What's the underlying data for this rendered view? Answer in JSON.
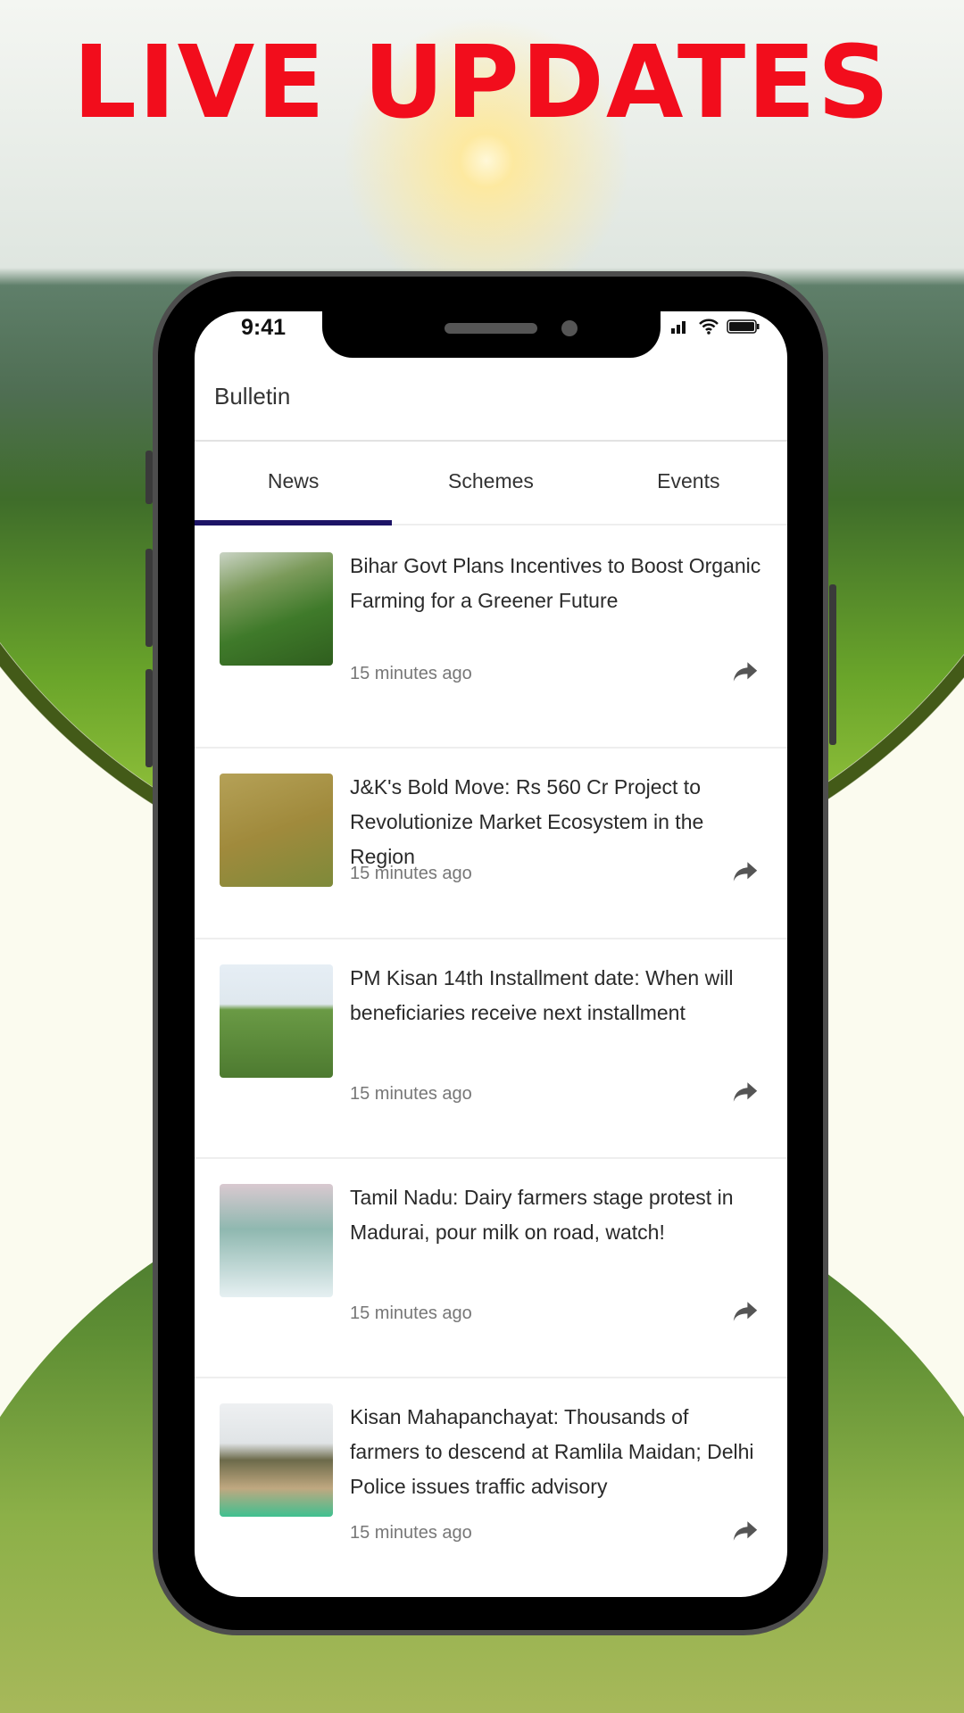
{
  "banner": {
    "headline": "LIVE UPDATES"
  },
  "status_bar": {
    "time": "9:41"
  },
  "app": {
    "title": "Bulletin",
    "tabs": [
      {
        "label": "News",
        "active": true
      },
      {
        "label": "Schemes"
      },
      {
        "label": "Events"
      }
    ],
    "accent_color": "#1d1466",
    "news": [
      {
        "title": "Bihar Govt Plans Incentives to Boost Organic Farming for a Greener Future",
        "time": "15 minutes ago"
      },
      {
        "title": "J&K's Bold Move: Rs 560 Cr Project to Revolutionize Market Ecosystem in the Region",
        "time": "15 minutes ago"
      },
      {
        "title": "PM Kisan 14th Installment date: When will beneficiaries receive next installment",
        "time": "15 minutes ago"
      },
      {
        "title": "Tamil Nadu: Dairy farmers stage protest in Madurai, pour milk on road, watch!",
        "time": "15 minutes ago"
      },
      {
        "title": "Kisan Mahapanchayat: Thousands of farmers to descend at Ramlila Maidan; Delhi Police issues traffic advisory",
        "time": "15 minutes ago"
      }
    ]
  }
}
